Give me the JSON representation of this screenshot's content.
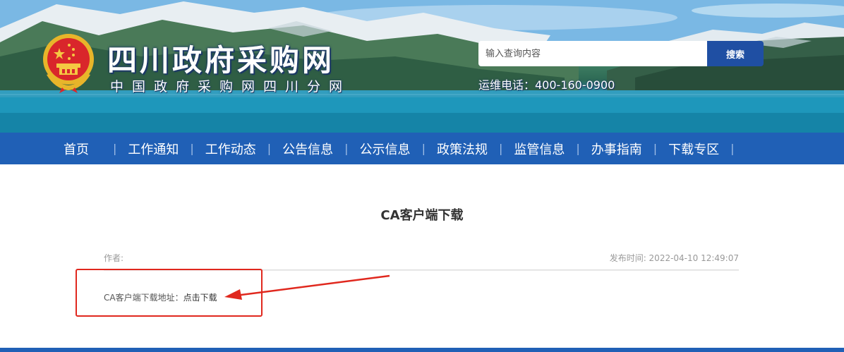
{
  "header": {
    "site_title": "四川政府采购网",
    "site_subtitle": "中国政府采购网四川分网",
    "search": {
      "placeholder": "输入查询内容",
      "button_label": "搜索"
    },
    "hotline": "运维电话：400-160-0900"
  },
  "nav": {
    "items": [
      {
        "label": "首页"
      },
      {
        "label": "工作通知"
      },
      {
        "label": "工作动态"
      },
      {
        "label": "公告信息"
      },
      {
        "label": "公示信息"
      },
      {
        "label": "政策法规"
      },
      {
        "label": "监管信息"
      },
      {
        "label": "办事指南"
      },
      {
        "label": "下载专区"
      }
    ],
    "separator": "|"
  },
  "article": {
    "title": "CA客户端下载",
    "author_label": "作者:",
    "publish_time": "发布时间: 2022-04-10 12:49:07",
    "download_label": "CA客户端下载地址：",
    "download_link": "点击下载"
  },
  "annotation": {
    "box_color": "#e0281e",
    "arrow_color": "#e0281e"
  },
  "colors": {
    "nav_bg": "#2060b6",
    "search_button": "#1f4fa3"
  }
}
